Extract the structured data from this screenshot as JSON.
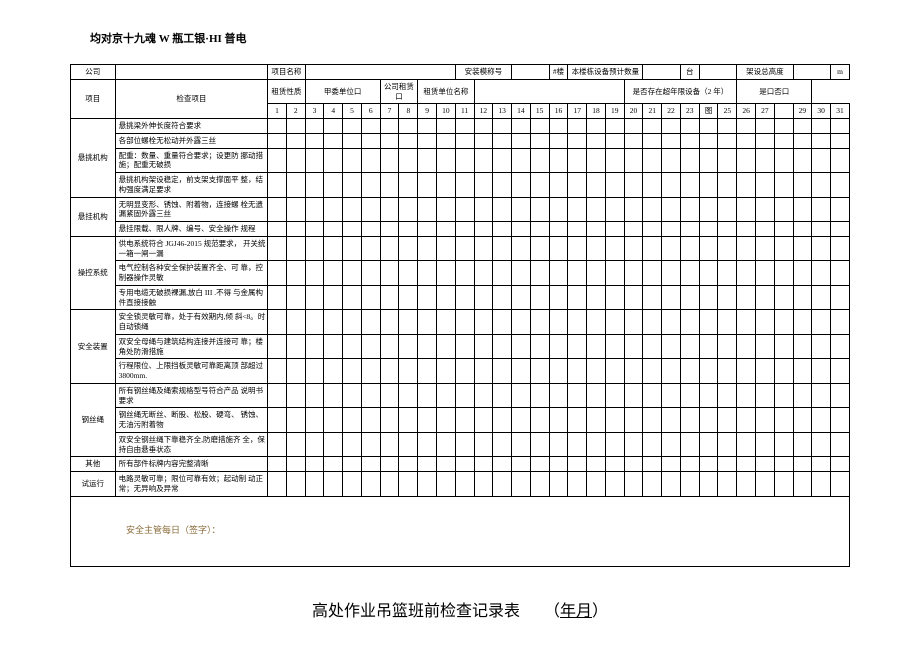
{
  "header_text": "均对京十九魂 W 瓶工银·HI 普电",
  "top_row": {
    "company": "公司",
    "project_name": "项目名称",
    "install_model": "安装模称号",
    "building_suffix": "#楼",
    "building_equip_count": "本楼栋设备预计数量",
    "unit_tai": "台",
    "erect_height": "架设总高度",
    "unit_m": "m"
  },
  "second_row": {
    "project": "项目",
    "check_item": "检查项目",
    "rent_nature": "租赁性质",
    "party_a_unit": "甲委单位口",
    "company_rent": "公司租赁口",
    "rent_unit_name": "租赁单位名称",
    "over_year_equip": "是否存在超年限设备（2 年）",
    "is_no": "是口否口"
  },
  "categories": {
    "suspend_mech": "悬挑机构",
    "hang_mech": "悬挂机构",
    "operate_sys": "操控系统",
    "safety_device": "安全装置",
    "wire_rope": "钢丝绳",
    "other": "其他",
    "test_run": "试运行"
  },
  "items": {
    "r1": "悬挑梁外伸长度符合要求",
    "r2": "各部位螺栓无松动并外露三丝",
    "r3": "配重：数量、重量符合要求；设更防\n挪动措施；配重无破损",
    "r4": "悬挑机构架设稳定，前支架支撑面平\n整，结构强度满足要求",
    "r5": "无明显变形、锈蚀、附着物，连接螺\n栓无遗漏紧固外露三丝",
    "r6": "悬挂限载、限人牌、编号、安全操作\n规程",
    "r7": "供电系统符合 JGJ46-2015 规范要求，\n开关统一箱一闸一漏",
    "r8": "电气控制各种安全保护装置齐全、可\n靠，控制器操作灵敏",
    "r9": "专用电缆无破损裸漏,放白 III .不得\n与金属构件直接接触",
    "r10": "安全锁灵敏可靠，处于有效期内,倾\n斜<8。时自动锁绳",
    "r11": "双安全母绳与建筑结构连接并连接可\n靠；楼角处防滑措施",
    "r12": "行程限位、上限挡板灵敏可靠距离顶\n部超过3800mm.",
    "r13": "所有钢丝绳及绳索规格型号符合产品\n说明书要求",
    "r14": "钢丝绳无断丝、断股、松股、硬弯、\n锈蚀、无油污附着物",
    "r15": "双安全钢丝绳下靠稳齐全,防磨措施齐\n全，保持自由悬垂状态",
    "r16": "所有部件标牌内容完整清晰",
    "r17": "电路灵敏可靠；限位可靠有效；起动制\n动正常；无异响及异常"
  },
  "signature": "安全主管每日（签字）：",
  "footer": {
    "title": "高处作业吊篮班前检查记录表",
    "paren_open": "（",
    "year_month": "年月",
    "paren_close": "）"
  },
  "nums": [
    "1",
    "2",
    "3",
    "4",
    "5",
    "6",
    "7",
    "8",
    "9",
    "10",
    "11",
    "12",
    "13",
    "14",
    "15",
    "16",
    "17",
    "18",
    "19",
    "20",
    "21",
    "22",
    "23",
    "图",
    "25",
    "26",
    "27",
    "",
    "29",
    "30",
    "31"
  ]
}
